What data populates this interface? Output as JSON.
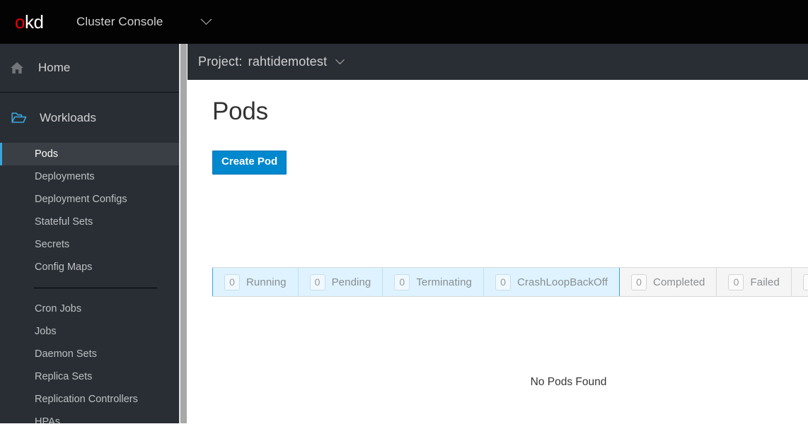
{
  "masthead": {
    "logo_text": "okd",
    "logo_o": "o",
    "logo_kd": "kd",
    "console_label": "Cluster Console",
    "chevron_icon": "chevron-down-icon",
    "background": "#030303"
  },
  "sidebar": {
    "home": {
      "label": "Home",
      "icon": "home-icon"
    },
    "section": {
      "label": "Workloads",
      "icon": "folder-open-icon"
    },
    "items": [
      {
        "label": "Pods",
        "active": true
      },
      {
        "label": "Deployments",
        "active": false
      },
      {
        "label": "Deployment Configs",
        "active": false
      },
      {
        "label": "Stateful Sets",
        "active": false
      },
      {
        "label": "Secrets",
        "active": false
      },
      {
        "label": "Config Maps",
        "active": false
      }
    ],
    "items2": [
      {
        "label": "Cron Jobs"
      },
      {
        "label": "Jobs"
      },
      {
        "label": "Daemon Sets"
      },
      {
        "label": "Replica Sets"
      },
      {
        "label": "Replication Controllers"
      },
      {
        "label": "HPAs"
      }
    ],
    "active_accent": "#39a5dc",
    "background": "#292e34"
  },
  "project_bar": {
    "label": "Project:",
    "name": "rahtidemotest",
    "chevron_icon": "chevron-down-icon"
  },
  "main": {
    "title": "Pods",
    "create_button": "Create Pod",
    "create_button_color": "#0088ce",
    "empty_message": "No Pods Found"
  },
  "status_filters": {
    "selected_group_border": "#39a5dc",
    "selected_background": "#def3ff",
    "tabs": [
      {
        "count": "0",
        "label": "Running",
        "selected": true
      },
      {
        "count": "0",
        "label": "Pending",
        "selected": true
      },
      {
        "count": "0",
        "label": "Terminating",
        "selected": true
      },
      {
        "count": "0",
        "label": "CrashLoopBackOff",
        "selected": true
      },
      {
        "count": "0",
        "label": "Completed",
        "selected": false
      },
      {
        "count": "0",
        "label": "Failed",
        "selected": false
      },
      {
        "count": "0",
        "label": "",
        "selected": false
      }
    ]
  },
  "scrollbar": {
    "name": "sidebar-scrollbar"
  }
}
